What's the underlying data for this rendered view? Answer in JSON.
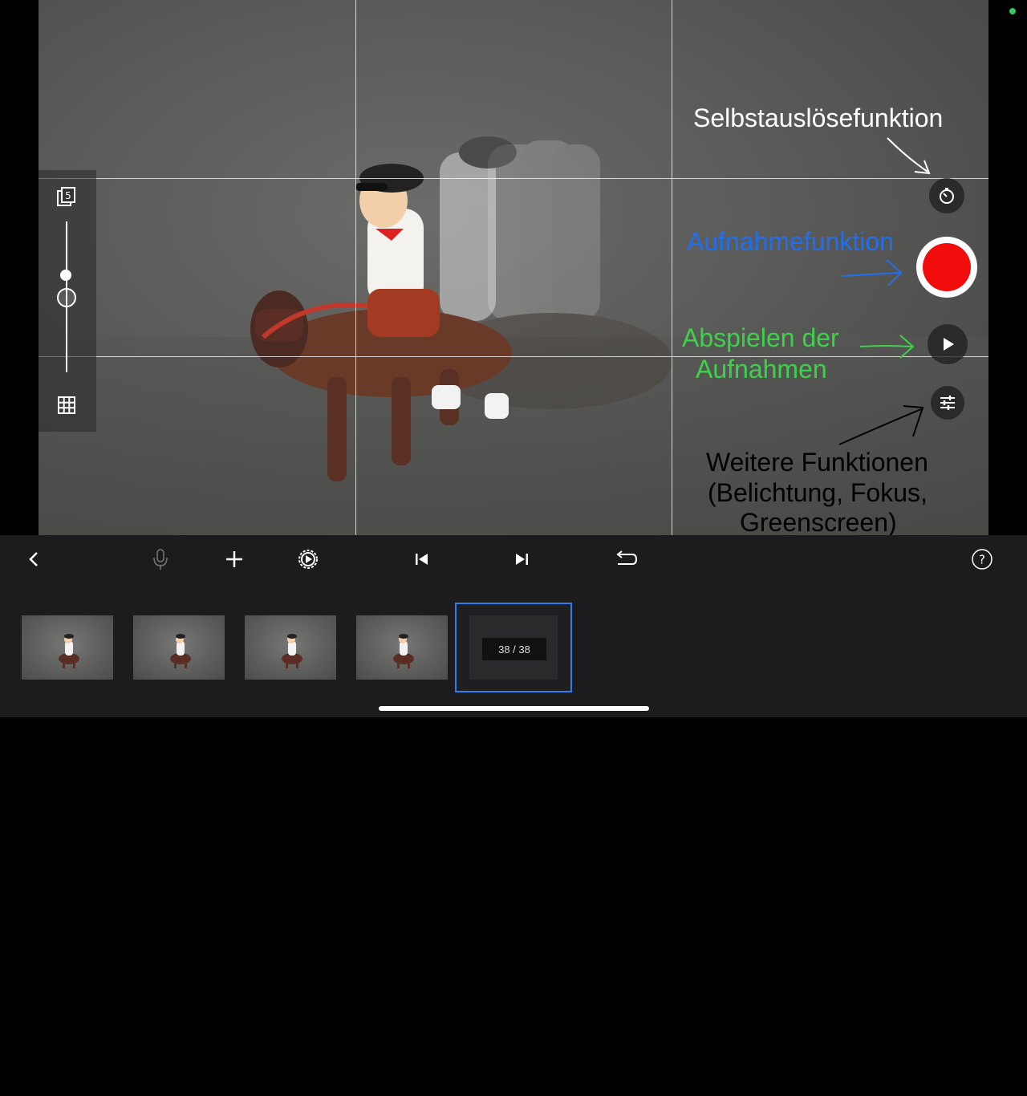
{
  "annotations": {
    "timer_label": "Selbstauslösefunktion",
    "record_label": "Aufnahmefunktion",
    "play_label_line1": "Abspielen der",
    "play_label_line2": "Aufnahmen",
    "more_label_line1": "Weitere Funktionen",
    "more_label_line2": "(Belichtung, Fokus,",
    "more_label_line3": "Greenscreen)"
  },
  "left_panel": {
    "onion_skin_count": "5"
  },
  "filmstrip": {
    "frame_counter": "38 / 38",
    "thumbnail_count": 4
  },
  "colors": {
    "record": "#f20d0d",
    "accent_selected": "#2d7ef5",
    "annotation_blue": "#1f6ff0",
    "annotation_green": "#3ed24a",
    "annotation_white": "#ffffff",
    "annotation_black": "#000000"
  },
  "icons": {
    "toolbar": [
      "back-icon",
      "microphone-icon",
      "add-icon",
      "settings-play-icon",
      "skip-start-icon",
      "skip-end-icon",
      "undo-icon",
      "help-icon"
    ],
    "camera": [
      "timer-icon",
      "record-icon",
      "play-icon",
      "sliders-icon"
    ],
    "left": [
      "onion-skin-icon",
      "grid-icon"
    ]
  }
}
